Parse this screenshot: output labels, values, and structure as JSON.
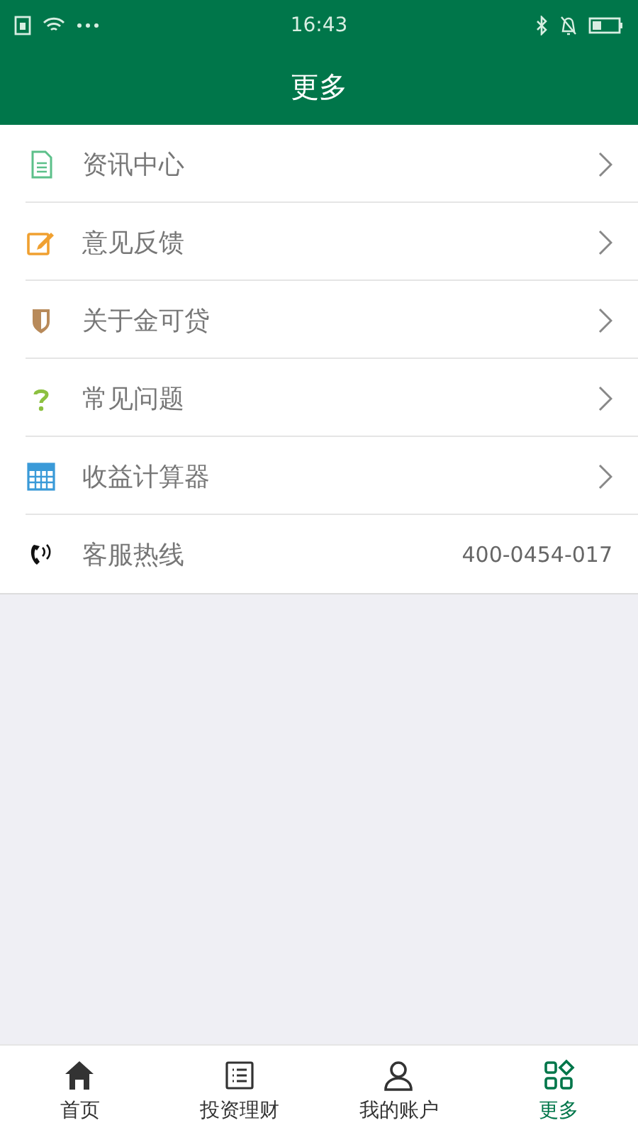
{
  "status_bar": {
    "time": "16:43"
  },
  "header": {
    "title": "更多"
  },
  "menu": [
    {
      "kind": "document",
      "label": "资讯中心",
      "chevron": true
    },
    {
      "kind": "edit",
      "label": "意见反馈",
      "chevron": true
    },
    {
      "kind": "shield",
      "label": "关于金可贷",
      "chevron": true
    },
    {
      "kind": "question",
      "label": "常见问题",
      "chevron": true
    },
    {
      "kind": "calculator",
      "label": "收益计算器",
      "chevron": true
    },
    {
      "kind": "phone",
      "label": "客服热线",
      "value": "400-0454-017",
      "chevron": false
    }
  ],
  "tabs": [
    {
      "kind": "home",
      "label": "首页",
      "selected": false
    },
    {
      "kind": "list",
      "label": "投资理财",
      "selected": false
    },
    {
      "kind": "user",
      "label": "我的账户",
      "selected": false
    },
    {
      "kind": "grid",
      "label": "更多",
      "selected": true
    }
  ]
}
